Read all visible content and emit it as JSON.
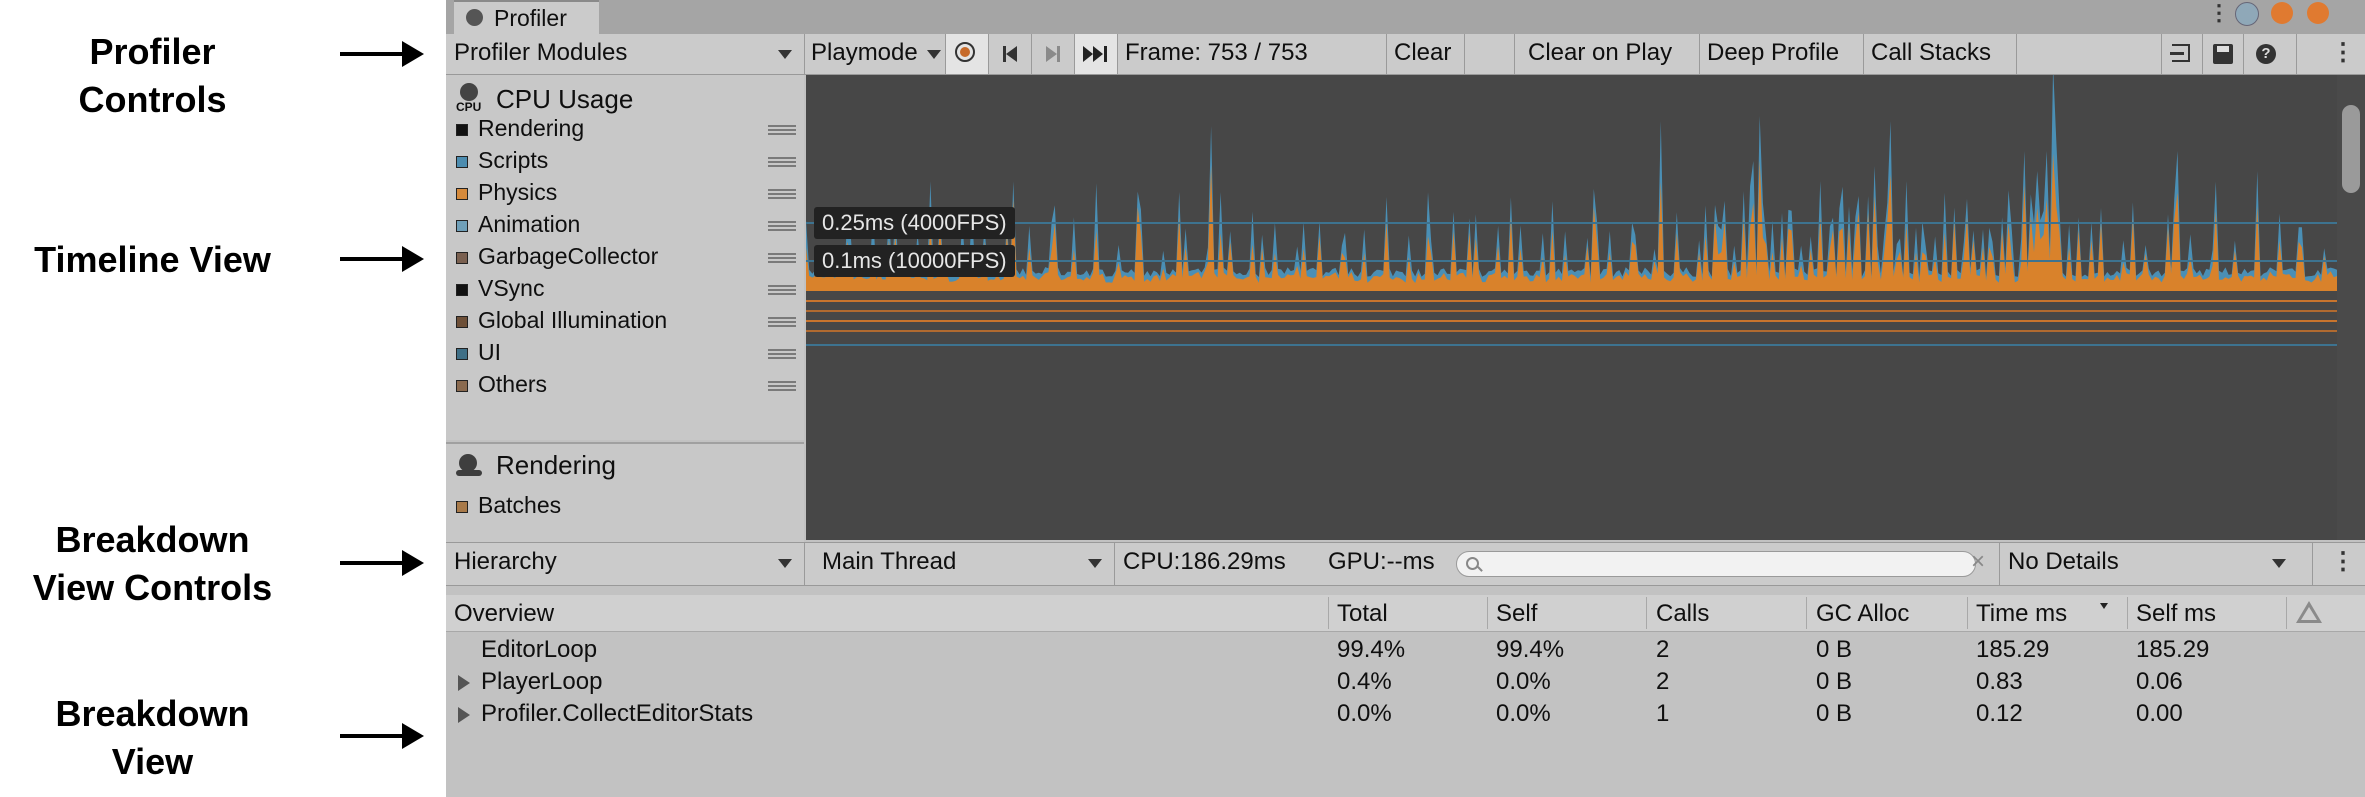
{
  "annotations": {
    "profiler_controls": [
      "Profiler",
      "Controls"
    ],
    "timeline_view": [
      "Timeline View"
    ],
    "breakdown_controls": [
      "Breakdown",
      "View Controls"
    ],
    "breakdown_view": [
      "Breakdown",
      "View"
    ]
  },
  "window": {
    "tab_title": "Profiler"
  },
  "toolbar": {
    "modules_dropdown": "Profiler Modules",
    "playmode_dropdown": "Playmode",
    "frame": "Frame: 753 / 753",
    "clear": "Clear",
    "clear_on_play": "Clear on Play",
    "deep_profile": "Deep Profile",
    "call_stacks": "Call Stacks"
  },
  "cpu_module": {
    "title": "CPU Usage",
    "icon_caption": "CPU",
    "items": [
      {
        "label": "Rendering",
        "color": "#111111"
      },
      {
        "label": "Scripts",
        "color": "#4d8db0"
      },
      {
        "label": "Physics",
        "color": "#d58a3c"
      },
      {
        "label": "Animation",
        "color": "#6f9fb8"
      },
      {
        "label": "GarbageCollector",
        "color": "#7a6050"
      },
      {
        "label": "VSync",
        "color": "#111111"
      },
      {
        "label": "Global Illumination",
        "color": "#6e5038"
      },
      {
        "label": "UI",
        "color": "#3f6f86"
      },
      {
        "label": "Others",
        "color": "#8a6a4f"
      }
    ]
  },
  "chart_labels": {
    "line1": "0.25ms (4000FPS)",
    "line2": "0.1ms (10000FPS)"
  },
  "rendering_module": {
    "title": "Rendering",
    "items": [
      {
        "label": "Batches",
        "color": "#a87a4a"
      }
    ]
  },
  "breakdown_controls": {
    "view_dropdown": "Hierarchy",
    "thread_dropdown": "Main Thread",
    "cpu": "CPU:186.29ms",
    "gpu": "GPU:--ms",
    "search_value": "",
    "details_dropdown": "No Details"
  },
  "breakdown": {
    "columns": [
      "Overview",
      "Total",
      "Self",
      "Calls",
      "GC Alloc",
      "Time ms",
      "Self ms"
    ],
    "rows": [
      {
        "name": "EditorLoop",
        "expandable": false,
        "total": "99.4%",
        "self": "99.4%",
        "calls": "2",
        "gc": "0 B",
        "time": "185.29",
        "selfms": "185.29"
      },
      {
        "name": "PlayerLoop",
        "expandable": true,
        "total": "0.4%",
        "self": "0.0%",
        "calls": "2",
        "gc": "0 B",
        "time": "0.83",
        "selfms": "0.06"
      },
      {
        "name": "Profiler.CollectEditorStats",
        "expandable": true,
        "total": "0.0%",
        "self": "0.0%",
        "calls": "1",
        "gc": "0 B",
        "time": "0.12",
        "selfms": "0.00"
      }
    ]
  },
  "colors": {
    "scripts": "#4a8fb5",
    "physics": "#d9822b",
    "chart_bg": "#474747"
  }
}
